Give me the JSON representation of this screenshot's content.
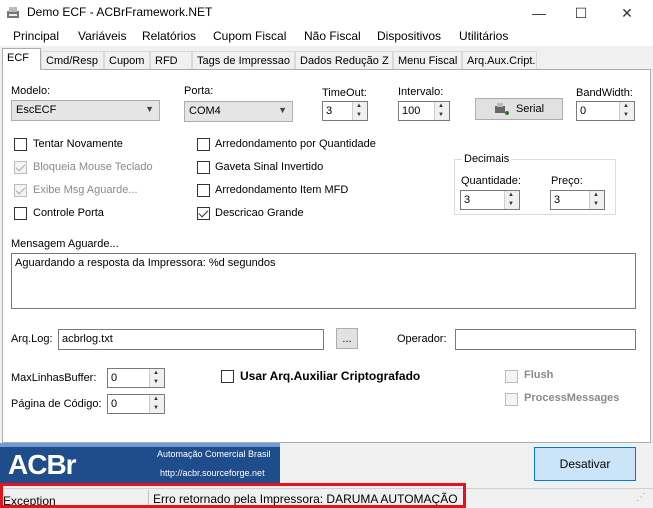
{
  "window": {
    "title": "Demo ECF - ACBrFramework.NET",
    "minimize_glyph": "—",
    "maximize_glyph": "☐",
    "close_glyph": "✕"
  },
  "menu": [
    "Principal",
    "Variáveis",
    "Relatórios",
    "Cupom Fiscal",
    "Não Fiscal",
    "Dispositivos",
    "Utilitários"
  ],
  "tabs": [
    "ECF",
    "Cmd/Resp",
    "Cupom",
    "RFD",
    "Tags de Impressao",
    "Dados Redução Z",
    "Menu Fiscal",
    "Arq.Aux.Cript."
  ],
  "form": {
    "modelo_label": "Modelo:",
    "modelo_value": "EscECF",
    "porta_label": "Porta:",
    "porta_value": "COM4",
    "timeout_label": "TimeOut:",
    "timeout_value": "3",
    "intervalo_label": "Intervalo:",
    "intervalo_value": "100",
    "serial_button": "Serial",
    "bandwidth_label": "BandWidth:",
    "bandwidth_value": "0",
    "checks_left": [
      {
        "label": "Tentar Novamente",
        "checked": false,
        "disabled": false
      },
      {
        "label": "Bloqueia Mouse Teclado",
        "checked": true,
        "disabled": true
      },
      {
        "label": "Exibe Msg Aguarde...",
        "checked": true,
        "disabled": true
      },
      {
        "label": "Controle Porta",
        "checked": false,
        "disabled": false
      }
    ],
    "checks_mid": [
      {
        "label": "Arredondamento por Quantidade",
        "checked": false
      },
      {
        "label": "Gaveta Sinal Invertido",
        "checked": false
      },
      {
        "label": "Arredondamento Item MFD",
        "checked": false
      },
      {
        "label": "Descricao Grande",
        "checked": true
      }
    ],
    "decimais_title": "Decimais",
    "quantidade_label": "Quantidade:",
    "quantidade_value": "3",
    "preco_label": "Preço:",
    "preco_value": "3",
    "mensagem_label": "Mensagem Aguarde...",
    "mensagem_value": "Aguardando a resposta da Impressora: %d segundos",
    "arqlog_label": "Arq.Log:",
    "arqlog_value": "acbrlog.txt",
    "browse_button": "...",
    "operador_label": "Operador:",
    "operador_value": "",
    "maxlinhas_label": "MaxLinhasBuffer:",
    "maxlinhas_value": "0",
    "pagina_label": "Página de Código:",
    "pagina_value": "0",
    "usar_arq_label": "Usar Arq.Auxiliar Criptografado",
    "flush_label": "Flush",
    "process_label": "ProcessMessages"
  },
  "banner": {
    "logo_text": "ACBr",
    "line1": "Automação Comercial Brasil",
    "line2": "http://acbr.sourceforge.net"
  },
  "desativar_button": "Desativar",
  "status": {
    "left": "Exception",
    "message": "Erro retornado pela Impressora: DARUMA AUTOMAÇÃO"
  },
  "colors": {
    "banner": "#1f4c8a",
    "highlight": "#e0141e",
    "desativar": "#cce4f7"
  }
}
